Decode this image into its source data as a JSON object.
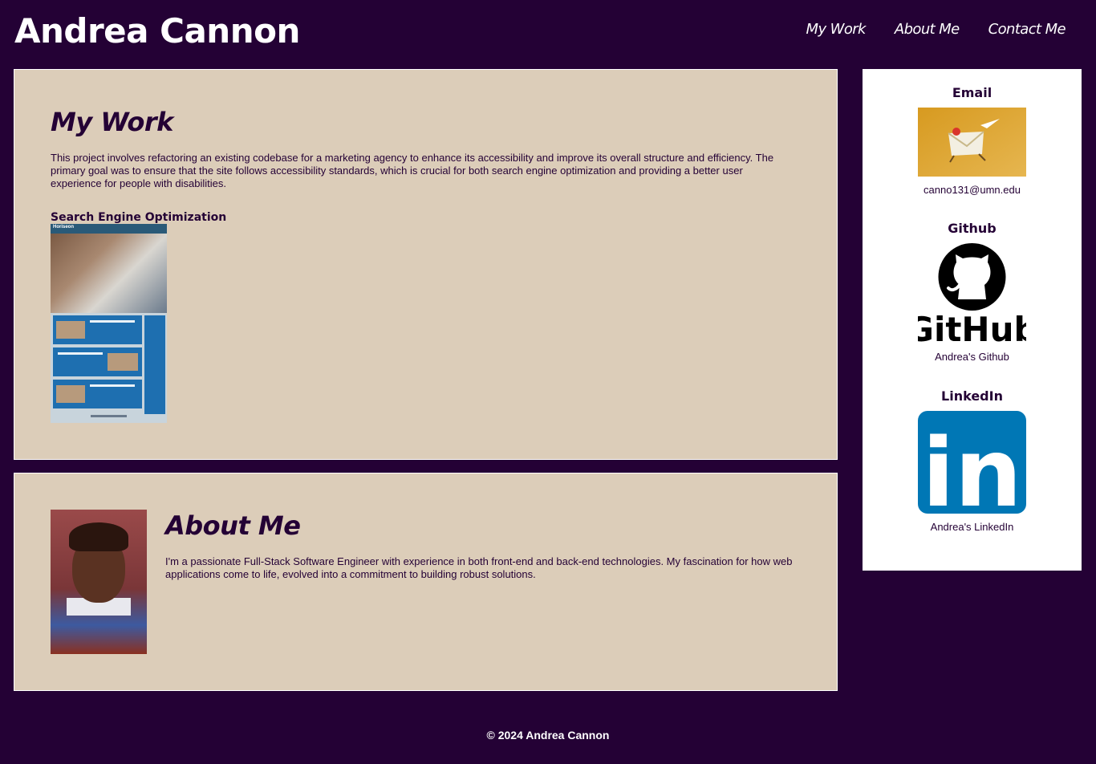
{
  "header": {
    "title": "Andrea Cannon",
    "nav": [
      "My Work",
      "About Me",
      "Contact Me"
    ]
  },
  "work": {
    "heading": "My Work",
    "description": "This project involves refactoring an existing codebase for a marketing agency to enhance its accessibility and improve its overall structure and efficiency. The primary goal was to ensure that the site follows accessibility standards, which is crucial for both search engine optimization and providing a better user experience for people with disabilities.",
    "project_title": "Search Engine Optimization",
    "thumbnail_brand": "Horiseon"
  },
  "about": {
    "heading": "About Me",
    "description": "I'm a passionate Full-Stack Software Engineer with experience in both front-end and back-end technologies. My fascination for how web applications come to life, evolved into a commitment to building robust solutions."
  },
  "contact": {
    "email": {
      "heading": "Email",
      "caption": "canno131@umn.edu"
    },
    "github": {
      "heading": "Github",
      "caption": "Andrea's Github",
      "logo_text": "GitHub"
    },
    "linkedin": {
      "heading": "LinkedIn",
      "caption": "Andrea's LinkedIn",
      "logo_text": "in"
    }
  },
  "footer": {
    "text": "© 2024 Andrea Cannon"
  },
  "colors": {
    "background": "#240135",
    "panel": "#dccdb9",
    "text": "#240135",
    "linkedin_blue": "#0a66c2"
  }
}
